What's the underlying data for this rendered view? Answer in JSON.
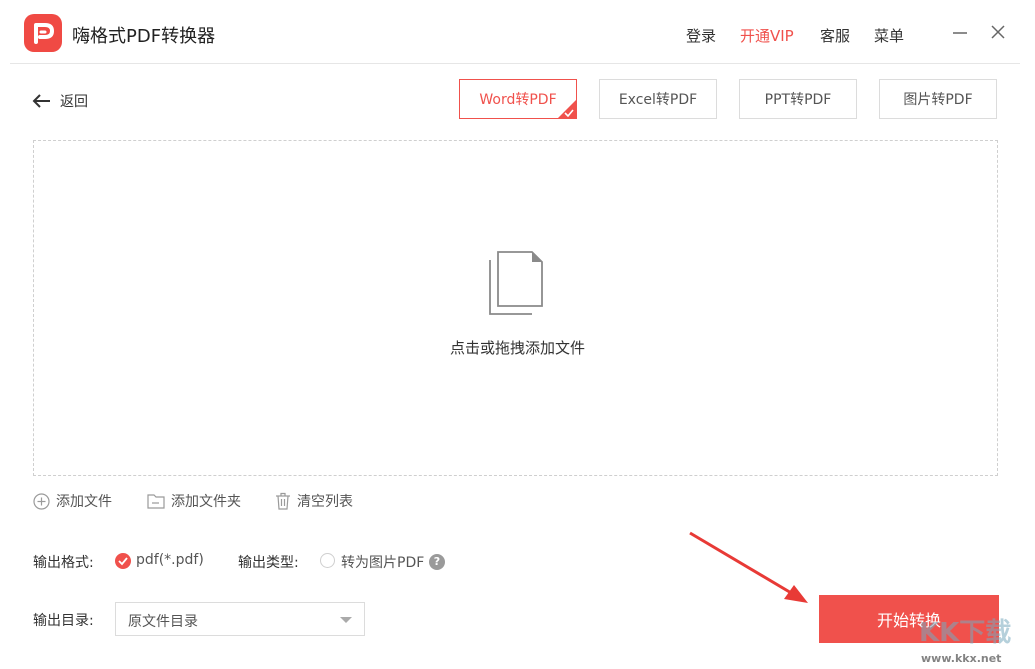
{
  "app": {
    "title": "嗨格式PDF转换器"
  },
  "topbar": {
    "login": "登录",
    "vip": "开通VIP",
    "service": "客服",
    "menu": "菜单"
  },
  "nav": {
    "back_label": "返回"
  },
  "tabs": [
    {
      "label": "Word转PDF",
      "active": true
    },
    {
      "label": "Excel转PDF",
      "active": false
    },
    {
      "label": "PPT转PDF",
      "active": false
    },
    {
      "label": "图片转PDF",
      "active": false
    }
  ],
  "dropzone": {
    "hint": "点击或拖拽添加文件"
  },
  "toolbar": {
    "add_file": "添加文件",
    "add_folder": "添加文件夹",
    "clear_list": "清空列表"
  },
  "options": {
    "format_label": "输出格式:",
    "format_value": "pdf(*.pdf)",
    "type_label": "输出类型:",
    "type_option": "转为图片PDF",
    "help_glyph": "?",
    "dir_label": "输出目录:",
    "dir_value": "原文件目录"
  },
  "start_button": "开始转换",
  "watermark": {
    "brand": "KK下载",
    "url": "www.kkx.net"
  },
  "colors": {
    "accent": "#f0514c",
    "border": "#dcdcdc"
  }
}
